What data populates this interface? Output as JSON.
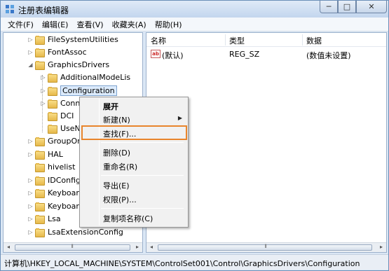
{
  "window": {
    "title": "注册表编辑器"
  },
  "titlebar": {
    "min_glyph": "─",
    "max_glyph": "□",
    "close_glyph": "✕"
  },
  "menubar": [
    "文件(F)",
    "编辑(E)",
    "查看(V)",
    "收藏夹(A)",
    "帮助(H)"
  ],
  "tree": {
    "items": [
      {
        "label": "FileSystemUtilities",
        "expander": "▷"
      },
      {
        "label": "FontAssoc",
        "expander": "▷"
      },
      {
        "label": "GraphicsDrivers",
        "expander": "◢"
      },
      {
        "label": "AdditionalModeLis",
        "expander": "▷"
      },
      {
        "label": "Configuration",
        "expander": "▷",
        "selected": true
      },
      {
        "label": "Conn",
        "expander": "▷"
      },
      {
        "label": "DCI",
        "expander": ""
      },
      {
        "label": "UseN",
        "expander": ""
      },
      {
        "label": "GroupOr",
        "expander": "▷"
      },
      {
        "label": "HAL",
        "expander": "▷"
      },
      {
        "label": "hivelist",
        "expander": ""
      },
      {
        "label": "IDConfig",
        "expander": "▷"
      },
      {
        "label": "Keyboar",
        "expander": "▷"
      },
      {
        "label": "Keyboar",
        "expander": "▷"
      },
      {
        "label": "Lsa",
        "expander": "▷"
      },
      {
        "label": "LsaExtensionConfig",
        "expander": "▷"
      }
    ]
  },
  "list": {
    "columns": [
      "名称",
      "类型",
      "数据"
    ],
    "rows": [
      {
        "icon": "ab",
        "name": "(默认)",
        "type": "REG_SZ",
        "data": "(数值未设置)"
      }
    ]
  },
  "context_menu": {
    "items": [
      {
        "label": "展开",
        "bold": true
      },
      {
        "label": "新建(N)",
        "submenu": true
      },
      {
        "label": "查找(F)...",
        "highlighted": true
      },
      {
        "label": "删除(D)"
      },
      {
        "label": "重命名(R)"
      },
      {
        "label": "导出(E)"
      },
      {
        "label": "权限(P)..."
      },
      {
        "label": "复制项名称(C)"
      }
    ],
    "submenu_arrow": "▶"
  },
  "scrollbar": {
    "left_arrow": "◂",
    "right_arrow": "▸",
    "grip": "⦀"
  },
  "statusbar": {
    "path": "计算机\\HKEY_LOCAL_MACHINE\\SYSTEM\\ControlSet001\\Control\\GraphicsDrivers\\Configuration"
  },
  "colors": {
    "highlight_border": "#e8852c",
    "selection_fill": "#dcebfc",
    "folder": "#e6b84a"
  }
}
